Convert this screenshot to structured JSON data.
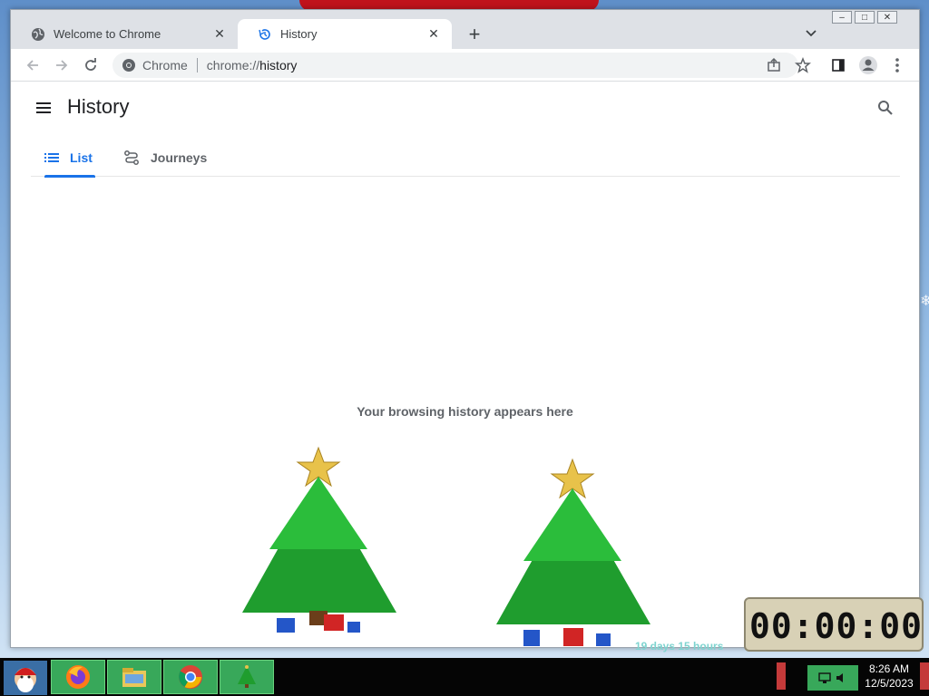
{
  "browser": {
    "tabs": [
      {
        "title": "Welcome to Chrome",
        "icon": "globe-icon",
        "active": false
      },
      {
        "title": "History",
        "icon": "history-icon",
        "active": true
      }
    ],
    "omnibox": {
      "site_label": "Chrome",
      "url_prefix": "chrome://",
      "url_path": "history"
    }
  },
  "history_page": {
    "title": "History",
    "tabs": [
      {
        "label": "List",
        "icon": "list-icon",
        "selected": true
      },
      {
        "label": "Journeys",
        "icon": "journeys-icon",
        "selected": false
      }
    ],
    "empty_message": "Your browsing history appears here"
  },
  "taskbar": {
    "apps": [
      "santa-start-icon",
      "firefox-icon",
      "file-manager-icon",
      "chrome-icon",
      "christmas-tree-icon"
    ],
    "clock_time": "8:26 AM",
    "clock_date": "12/5/2023"
  },
  "countdown_widget": {
    "display": "00:00:00",
    "banner": "19 days 15 hours"
  },
  "colors": {
    "accent": "#1a73e8",
    "taskbar": "#050505",
    "taskbar_app": "#38a85a"
  }
}
